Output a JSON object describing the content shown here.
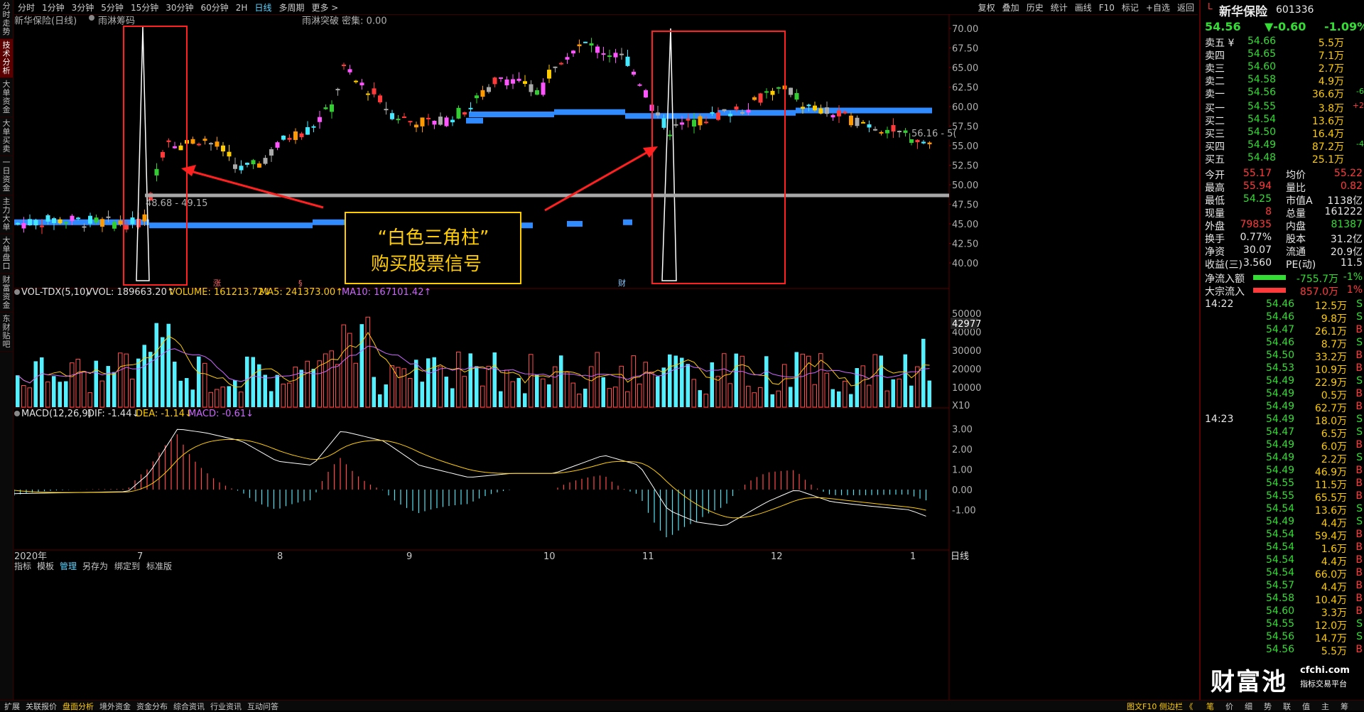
{
  "left_tabs": [
    "分时走势",
    "技术分析",
    "大单资金",
    "大单买卖",
    "一日资金",
    "主力大单",
    "大单盘口",
    "财富资金",
    "东财贴吧"
  ],
  "left_tab_active": 1,
  "periods": [
    "分时",
    "1分钟",
    "3分钟",
    "5分钟",
    "15分钟",
    "30分钟",
    "60分钟",
    "2H",
    "日线",
    "多周期",
    "更多 >"
  ],
  "period_active": 8,
  "toolbar": [
    "复权",
    "叠加",
    "历史",
    "统计",
    "画线",
    "F10",
    "标记",
    "+自选",
    "返回"
  ],
  "chart": {
    "title": "新华保险(日线)",
    "indicator_name": "雨淋筹码",
    "indicator_status": "雨淋突破  密集: 0.00",
    "price_axis": [
      "70.00",
      "67.50",
      "65.00",
      "62.50",
      "60.00",
      "57.50",
      "55.00",
      "52.50",
      "50.00",
      "47.50",
      "45.00",
      "42.50",
      "40.00"
    ],
    "current_price_tag": "56.16 - 5(",
    "range_label": "48.68 - 49.15",
    "annotation_line1": "“白色三角柱”",
    "annotation_line2": "购买股票信号",
    "event_markers": [
      "涨",
      "§",
      "财"
    ],
    "vol_title": "VOL-TDX(5,10)",
    "vvol": "VVOL: 189663.20↑",
    "volume": "VOLUME: 161213.72↓",
    "ma5": "MA5: 241373.00↑",
    "ma10": "MA10: 167101.42↑",
    "vol_axis": [
      "50000",
      "40000",
      "30000",
      "20000",
      "10000",
      "X10"
    ],
    "vol_current": "42977",
    "macd_title": "MACD(12,26,9)",
    "dif": "DIF: -1.44↓",
    "dea": "DEA: -1.14↓",
    "macd": "MACD: -0.61↓",
    "macd_axis": [
      "3.00",
      "2.00",
      "1.00",
      "0.00",
      "-1.00"
    ],
    "year_label": "2020年",
    "months": [
      "7",
      "8",
      "9",
      "10",
      "11",
      "12",
      "1"
    ],
    "period_label": "日线",
    "bottom_tools": [
      "指标",
      "模板",
      "管理",
      "另存为",
      "绑定到",
      "标准版"
    ]
  },
  "quote": {
    "name": "新华保险",
    "code": "601336",
    "flag": "L",
    "price": "54.56",
    "change": "▼-0.60",
    "pct": "-1.09%",
    "asks": [
      {
        "label": "卖五 ¥",
        "price": "54.66",
        "vol": "5.5万",
        "chg": ""
      },
      {
        "label": "卖四",
        "price": "54.65",
        "vol": "7.1万",
        "chg": ""
      },
      {
        "label": "卖三",
        "price": "54.60",
        "vol": "2.7万",
        "chg": ""
      },
      {
        "label": "卖二",
        "price": "54.58",
        "vol": "4.9万",
        "chg": ""
      },
      {
        "label": "卖一",
        "price": "54.56",
        "vol": "36.6万",
        "chg": "-6"
      }
    ],
    "bids": [
      {
        "label": "买一",
        "price": "54.55",
        "vol": "3.8万",
        "chg": "+2"
      },
      {
        "label": "买二",
        "price": "54.54",
        "vol": "13.6万",
        "chg": ""
      },
      {
        "label": "买三",
        "price": "54.50",
        "vol": "16.4万",
        "chg": ""
      },
      {
        "label": "买四",
        "price": "54.49",
        "vol": "87.2万",
        "chg": "-4"
      },
      {
        "label": "买五",
        "price": "54.48",
        "vol": "25.1万",
        "chg": ""
      }
    ],
    "stats": [
      {
        "l1": "今开",
        "v1": "55.17",
        "c1": "red",
        "l2": "均价",
        "v2": "55.22",
        "c2": "red"
      },
      {
        "l1": "最高",
        "v1": "55.94",
        "c1": "red",
        "l2": "量比",
        "v2": "0.82",
        "c2": "red"
      },
      {
        "l1": "最低",
        "v1": "54.25",
        "c1": "green",
        "l2": "市值A",
        "v2": "1138亿",
        "c2": "white"
      },
      {
        "l1": "现量",
        "v1": "8",
        "c1": "red",
        "l2": "总量",
        "v2": "161222",
        "c2": "white"
      },
      {
        "l1": "外盘",
        "v1": "79835",
        "c1": "red",
        "l2": "内盘",
        "v2": "81387",
        "c2": "green"
      },
      {
        "l1": "换手",
        "v1": "0.77%",
        "c1": "white",
        "l2": "股本",
        "v2": "31.2亿",
        "c2": "white"
      },
      {
        "l1": "净资",
        "v1": "30.07",
        "c1": "white",
        "l2": "流通",
        "v2": "20.9亿",
        "c2": "white"
      },
      {
        "l1": "收益(三)",
        "v1": "3.560",
        "c1": "white",
        "l2": "PE(动)",
        "v2": "11.5",
        "c2": "white"
      }
    ],
    "flows": [
      {
        "label": "净流入额",
        "val": "-755.7万",
        "pct": "-1%",
        "color": "green"
      },
      {
        "label": "大宗流入",
        "val": "857.0万",
        "pct": "1%",
        "color": "red"
      }
    ],
    "ticks_time1": "14:22",
    "ticks_time2": "14:23",
    "ticks": [
      {
        "p": "54.46",
        "v": "12.5万",
        "s": "S"
      },
      {
        "p": "54.46",
        "v": "9.8万",
        "s": "S"
      },
      {
        "p": "54.47",
        "v": "26.1万",
        "s": "B"
      },
      {
        "p": "54.46",
        "v": "8.7万",
        "s": "S"
      },
      {
        "p": "54.50",
        "v": "33.2万",
        "s": "B"
      },
      {
        "p": "54.53",
        "v": "10.9万",
        "s": "B"
      },
      {
        "p": "54.49",
        "v": "22.9万",
        "s": "S"
      },
      {
        "p": "54.49",
        "v": "0.5万",
        "s": "B"
      },
      {
        "p": "54.49",
        "v": "62.7万",
        "s": "B"
      },
      {
        "p": "54.49",
        "v": "18.0万",
        "s": "S"
      },
      {
        "p": "54.47",
        "v": "6.5万",
        "s": "S"
      },
      {
        "p": "54.49",
        "v": "6.0万",
        "s": "B"
      },
      {
        "p": "54.49",
        "v": "2.2万",
        "s": "S"
      },
      {
        "p": "54.49",
        "v": "46.9万",
        "s": "B"
      },
      {
        "p": "54.55",
        "v": "11.5万",
        "s": "B"
      },
      {
        "p": "54.55",
        "v": "65.5万",
        "s": "B"
      },
      {
        "p": "54.54",
        "v": "13.6万",
        "s": "S"
      },
      {
        "p": "54.49",
        "v": "4.4万",
        "s": "S"
      },
      {
        "p": "54.54",
        "v": "59.4万",
        "s": "B"
      },
      {
        "p": "54.54",
        "v": "1.6万",
        "s": "B"
      },
      {
        "p": "54.54",
        "v": "4.4万",
        "s": "B"
      },
      {
        "p": "54.54",
        "v": "66.0万",
        "s": "B"
      },
      {
        "p": "54.57",
        "v": "4.4万",
        "s": "B"
      },
      {
        "p": "54.58",
        "v": "10.4万",
        "s": "B"
      },
      {
        "p": "54.60",
        "v": "3.3万",
        "s": "B"
      },
      {
        "p": "54.55",
        "v": "12.0万",
        "s": "S"
      },
      {
        "p": "54.56",
        "v": "14.7万",
        "s": "S"
      },
      {
        "p": "54.56",
        "v": "5.5万",
        "s": "B"
      }
    ]
  },
  "watermark": "财富池",
  "watermark_site": "cfchi.com",
  "watermark_sub": "指标交易平台",
  "bottom_tabs": [
    "扩展",
    "关联报价",
    "盘面分析",
    "境外资金",
    "资金分布",
    "综合资讯",
    "行业资讯",
    "互动问答"
  ],
  "bottom_active": 2,
  "bottom_right": "图文F10 侧边栏 《",
  "right_bottom_tabs": [
    "笔",
    "价",
    "细",
    "势",
    "联",
    "值",
    "主",
    "筹"
  ],
  "colors": {
    "up": "#ff3a3a",
    "down": "#33dd33",
    "accent": "#5ad4ff",
    "highlight": "#ffcc00",
    "frame": "#ff2020"
  }
}
